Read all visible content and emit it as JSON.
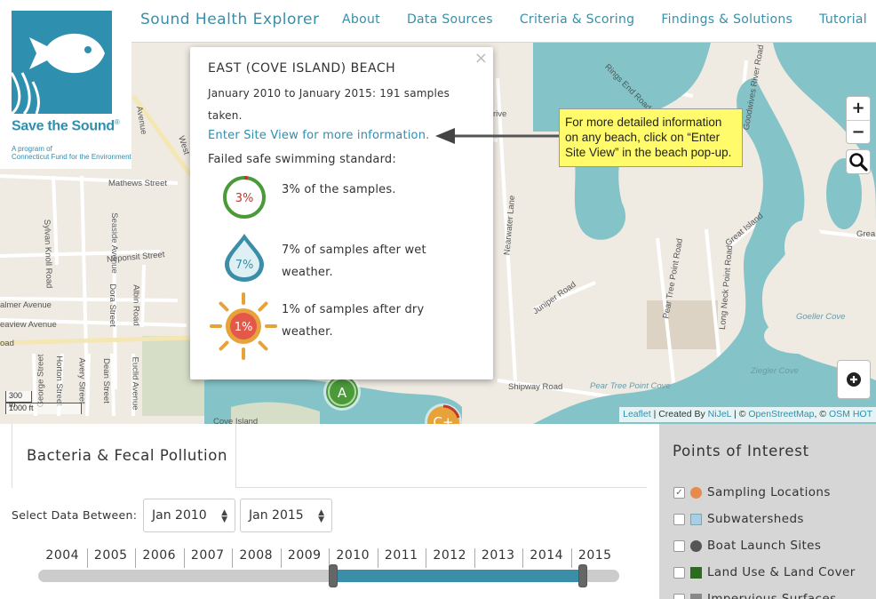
{
  "header": {
    "app_title": "Sound Health Explorer",
    "nav": [
      "About",
      "Data Sources",
      "Criteria & Scoring",
      "Findings & Solutions",
      "Tutorial"
    ]
  },
  "logo": {
    "brand": "Save the Sound",
    "reg": "®",
    "line1": "A program of",
    "line2": "Connecticut Fund for the Environment"
  },
  "map": {
    "zoom_in": "+",
    "zoom_out": "−",
    "scale_m": "300 m",
    "scale_ft": "1000 ft",
    "attribution": {
      "leaflet": "Leaflet",
      "created_by": " | Created By ",
      "nijel": "NiJeL",
      "osm_sep": " | © ",
      "osm": "OpenStreetMap",
      "hot_sep": ", © ",
      "hot": "OSM HOT"
    },
    "streets": {
      "avenue": "Avenue",
      "west": "West",
      "mathews": "Mathews Street",
      "sylvan": "Sylvan Knoll Road",
      "seaside": "Seaside Avenue",
      "neponsit": "Neponsit Street",
      "dora": "Dora Street",
      "albin": "Albin Road",
      "palmer": "almer Avenue",
      "seaview": "eaview Avenue",
      "oad": "oad",
      "george": "George Street",
      "horton": "Horton Street",
      "avery": "Avery Street",
      "dean": "Dean Street",
      "euclid": "Euclid Avenue",
      "rings_end": "Rings End Road",
      "goodwives": "Goodwives River Road",
      "rive": "rive",
      "nearwater": "Nearwater Lane",
      "juniper": "Juniper Road",
      "pear_tree": "Pear Tree Point Road",
      "long_neck": "Long Neck Point Road",
      "great_island": "Great Island",
      "grea": "Grea",
      "shipway": "Shipway Road",
      "cove_island": "Cove Island"
    },
    "waters": {
      "goeller": "Goeller Cove",
      "ziegler": "Ziegler Cove",
      "pear_tree_cove": "Pear Tree Point Cove"
    },
    "markers": [
      {
        "grade": "A",
        "color": "#4a9a3a"
      },
      {
        "grade": "C+",
        "color": "#e8a23a"
      }
    ]
  },
  "popup": {
    "close": "×",
    "title": "EAST (COVE ISLAND) BEACH",
    "range_line1": "January 2010 to January 2015: 191 samples",
    "range_line2": "taken.",
    "site_link": "Enter Site View for more information.",
    "failed_label": "Failed safe swimming standard:",
    "stats": [
      {
        "value": "3%",
        "text": "3% of the samples.",
        "fraction": 0.03,
        "icon": "ring-icon",
        "color": "#c0392b"
      },
      {
        "value": "7%",
        "text": "7% of samples after wet weather.",
        "fraction": 0.07,
        "icon": "raindrop-icon",
        "color": "#3a8ea8"
      },
      {
        "value": "1%",
        "text": "1% of samples after dry weather.",
        "fraction": 0.01,
        "icon": "sun-icon",
        "color": "#e8a23a"
      }
    ]
  },
  "callout": {
    "text": "For more detailed information on any beach, click on “Enter Site View” in the beach pop-up."
  },
  "panel": {
    "tab_label": "Bacteria & Fecal Pollution",
    "between_label": "Select Data Between:",
    "start_value": "Jan 2010",
    "end_value": "Jan 2015",
    "years": [
      "2004",
      "2005",
      "2006",
      "2007",
      "2008",
      "2009",
      "2010",
      "2011",
      "2012",
      "2013",
      "2014",
      "2015"
    ],
    "selected_start": "2010",
    "selected_end": "2015",
    "accent": "#3a8ea8"
  },
  "poi": {
    "title": "Points of Interest",
    "items": [
      {
        "label": "Sampling Locations",
        "checked": true,
        "swatch": "circle",
        "color": "#e8894e"
      },
      {
        "label": "Subwatersheds",
        "checked": false,
        "swatch": "square",
        "color": "#a9cde6"
      },
      {
        "label": "Boat Launch Sites",
        "checked": false,
        "swatch": "circle",
        "color": "#555555"
      },
      {
        "label": "Land Use & Land Cover",
        "checked": false,
        "swatch": "square",
        "color": "#2e6b1f"
      },
      {
        "label": "Impervious Surfaces",
        "checked": false,
        "swatch": "square",
        "color": "#888888"
      }
    ]
  }
}
